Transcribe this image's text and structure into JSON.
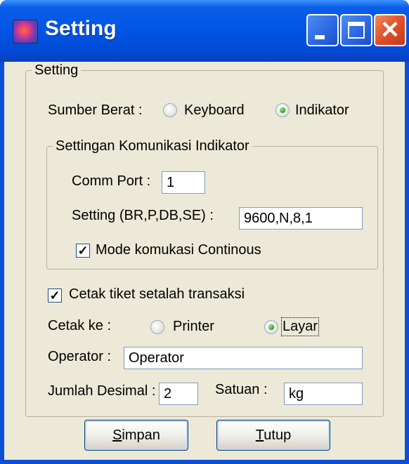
{
  "window": {
    "title": "Setting",
    "icon": "app-icon"
  },
  "group_setting": {
    "label": "Setting"
  },
  "sumber_berat": {
    "label": "Sumber Berat :",
    "options": [
      {
        "label": "Keyboard",
        "checked": false
      },
      {
        "label": "Indikator",
        "checked": true
      }
    ]
  },
  "comm_group": {
    "label": "Settingan Komunikasi Indikator",
    "comm_port_label": "Comm Port :",
    "comm_port_value": "1",
    "setting_label": "Setting (BR,P,DB,SE) :",
    "setting_value": "9600,N,8,1",
    "continuous_label": "Mode komukasi Continous",
    "continuous_checked": true
  },
  "cetak_tiket": {
    "label": "Cetak tiket setalah transaksi",
    "checked": true
  },
  "cetak_ke": {
    "label": "Cetak ke :",
    "options": [
      {
        "label": "Printer",
        "checked": false
      },
      {
        "label": "Layar",
        "checked": true
      }
    ]
  },
  "operator": {
    "label": "Operator :",
    "value": "Operator"
  },
  "jumlah_desimal": {
    "label": "Jumlah Desimal :",
    "value": "2"
  },
  "satuan": {
    "label": "Satuan :",
    "value": "kg"
  },
  "buttons": {
    "simpan_first": "S",
    "simpan_rest": "impan",
    "tutup_first": "T",
    "tutup_rest": "utup"
  },
  "colors": {
    "titlebar": "#0055e5",
    "face": "#ece9d8",
    "close": "#e0502a"
  }
}
